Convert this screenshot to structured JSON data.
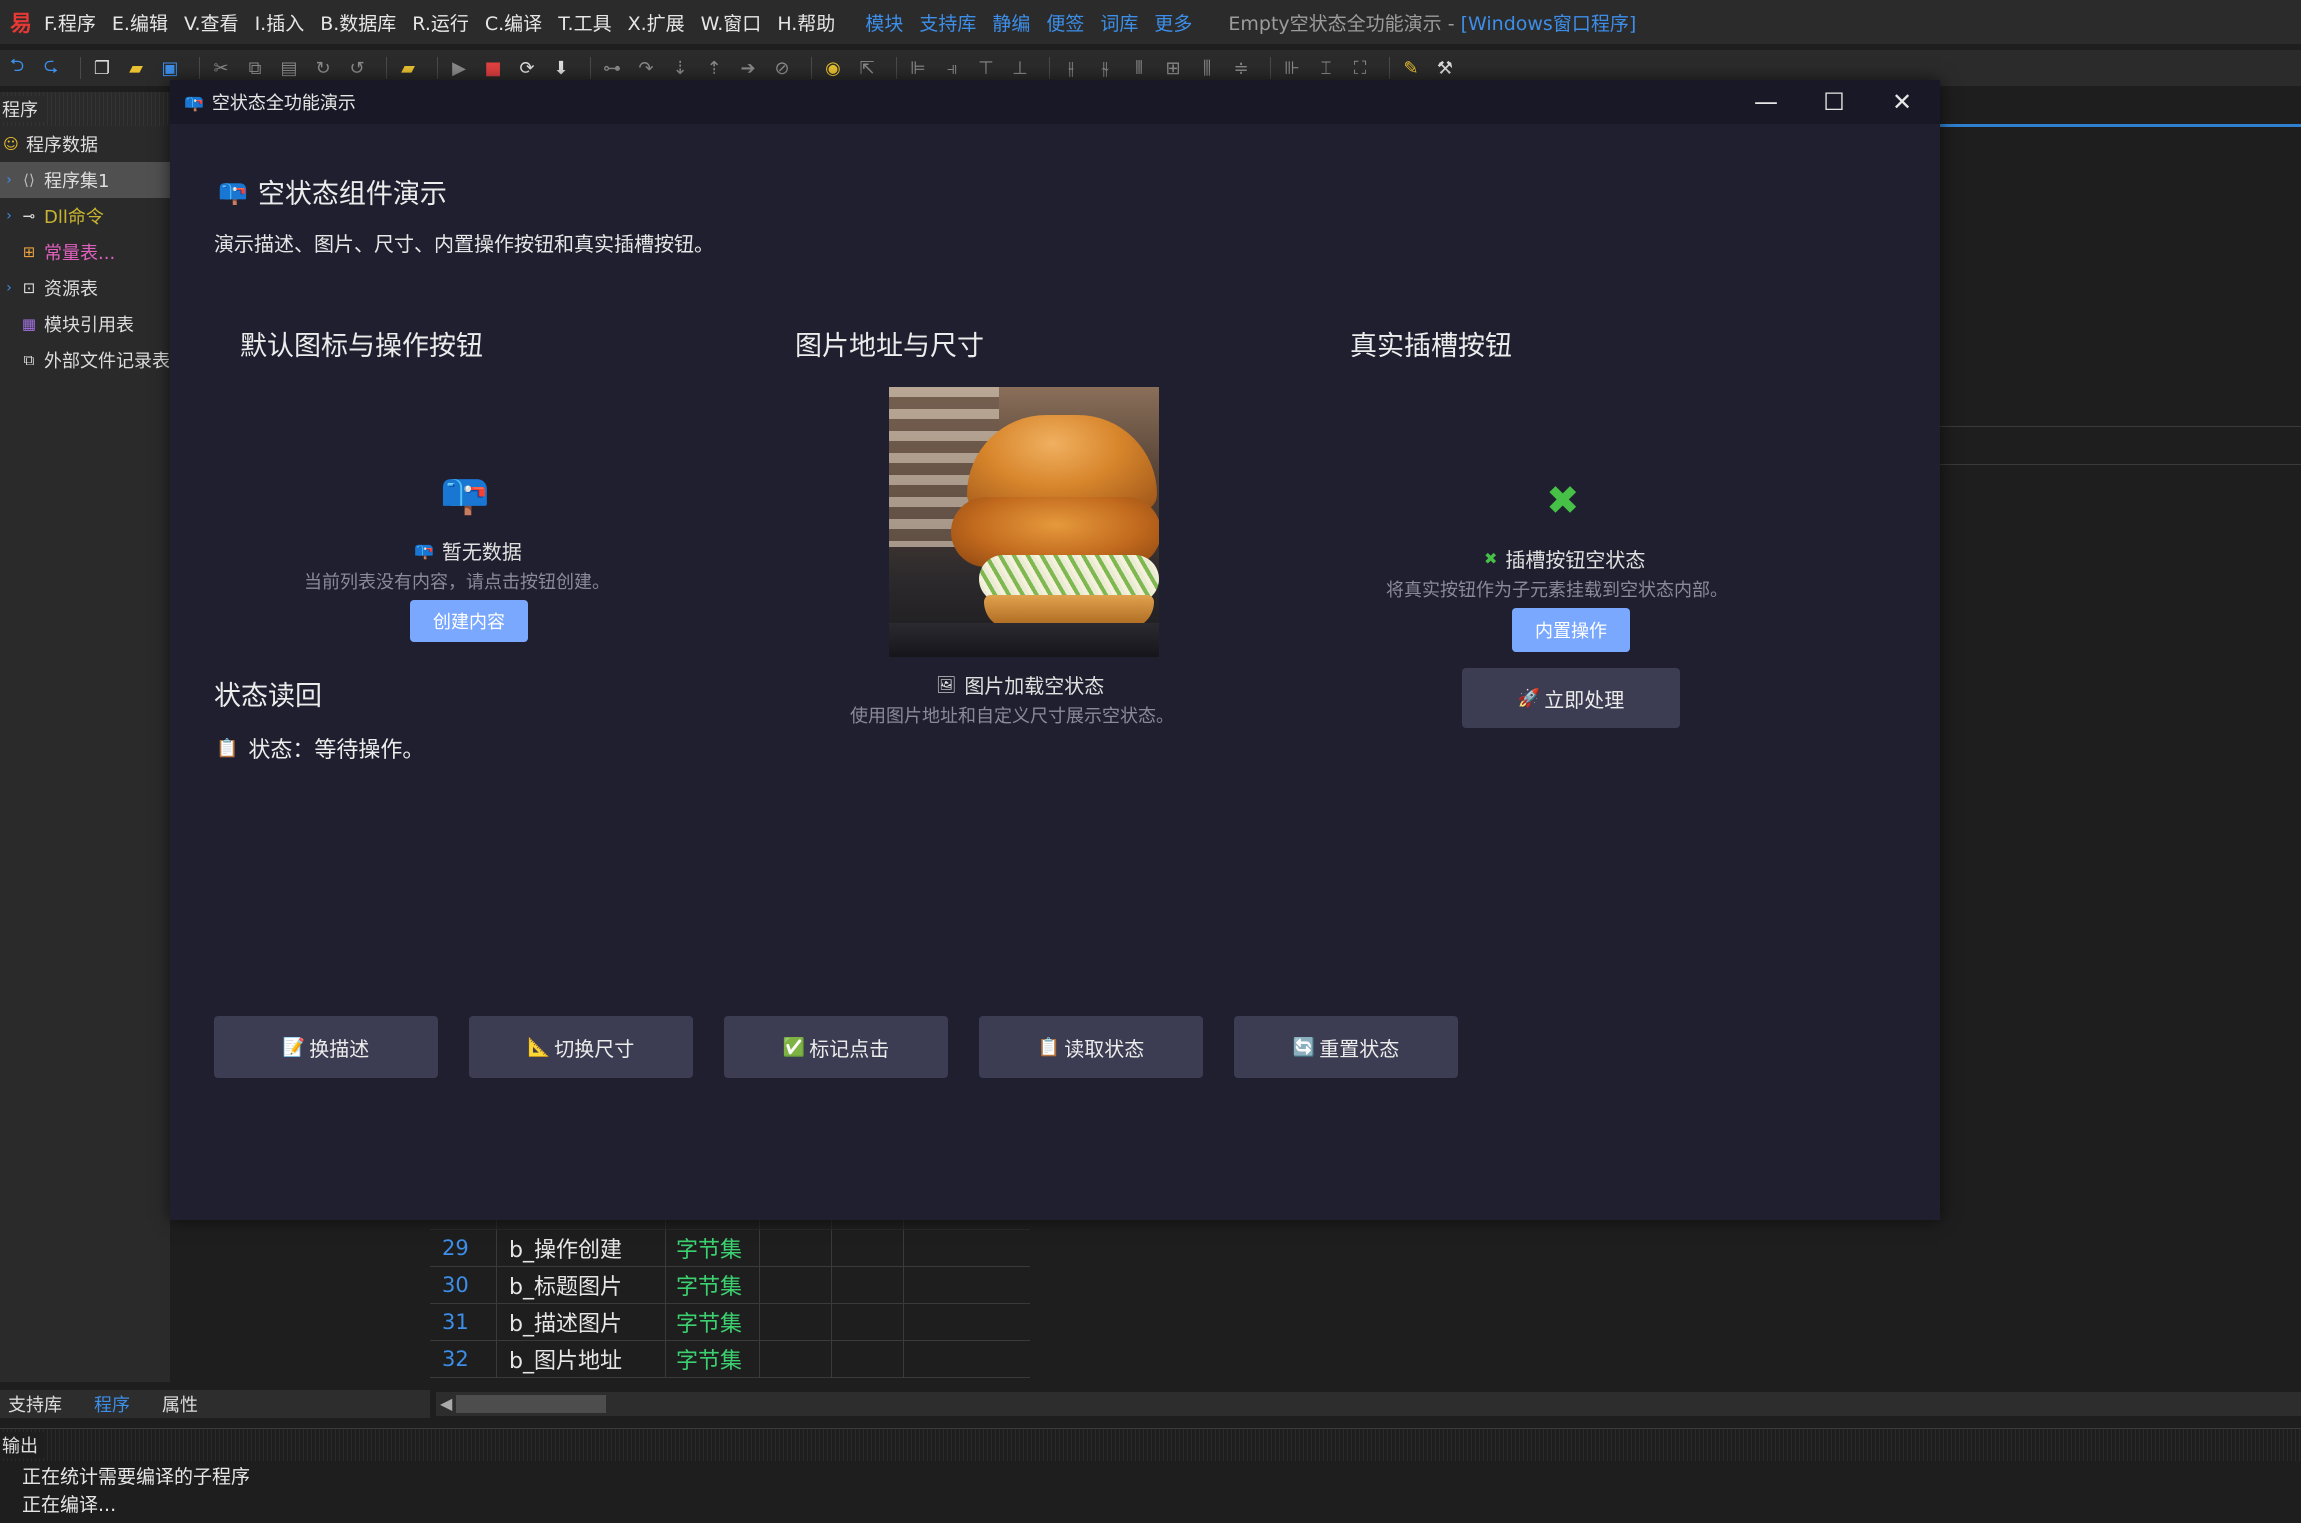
{
  "ide": {
    "logo": "易",
    "menus": [
      "F.程序",
      "E.编辑",
      "V.查看",
      "I.插入",
      "B.数据库",
      "R.运行",
      "C.编译",
      "T.工具",
      "X.扩展",
      "W.窗口",
      "H.帮助"
    ],
    "quick_links": [
      "模块",
      "支持库",
      "静编",
      "便签",
      "词库",
      "更多"
    ],
    "title_prefix": "Empty空状态全功能演示 - ",
    "title_suffix": "[Windows窗口程序]"
  },
  "side_panel": {
    "header": "程序",
    "items": [
      {
        "label": "程序数据",
        "icon": "☺"
      },
      {
        "label": "程序集1",
        "icon": "⟨⟩"
      },
      {
        "label": "Dll命令",
        "icon": "⊸"
      },
      {
        "label": "常量表...",
        "icon": "⊞"
      },
      {
        "label": "资源表",
        "icon": "⊡"
      },
      {
        "label": "模块引用表",
        "icon": "▦"
      },
      {
        "label": "外部文件记录表",
        "icon": "⧉"
      }
    ]
  },
  "editor": {
    "rows": [
      {
        "line": "29",
        "name": "b_操作创建",
        "type": "字节集"
      },
      {
        "line": "30",
        "name": "b_标题图片",
        "type": "字节集"
      },
      {
        "line": "31",
        "name": "b_描述图片",
        "type": "字节集"
      },
      {
        "line": "32",
        "name": "b_图片地址",
        "type": "字节集"
      }
    ]
  },
  "bottom_tabs": [
    "支持库",
    "程序",
    "属性"
  ],
  "output": {
    "header": "输出",
    "lines": [
      "正在统计需要编译的子程序",
      "正在编译..."
    ]
  },
  "dialog": {
    "title": "空状态全功能演示",
    "heading": "空状态组件演示",
    "description": "演示描述、图片、尺寸、内置操作按钮和真实插槽按钮。",
    "col1": {
      "title": "默认图标与操作按钮",
      "empty_title": "暂无数据",
      "empty_desc": "当前列表没有内容，请点击按钮创建。",
      "button": "创建内容"
    },
    "col2": {
      "title": "图片地址与尺寸",
      "empty_title": "图片加载空状态",
      "empty_desc": "使用图片地址和自定义尺寸展示空状态。"
    },
    "col3": {
      "title": "真实插槽按钮",
      "empty_title": "插槽按钮空状态",
      "empty_desc": "将真实按钮作为子元素挂载到空状态内部。",
      "builtin_button": "内置操作",
      "slot_button": "立即处理"
    },
    "status_title": "状态读回",
    "status_text": "状态：等待操作。",
    "actions": [
      "换描述",
      "切换尺寸",
      "标记点击",
      "读取状态",
      "重置状态"
    ]
  },
  "colors": {
    "accent_blue": "#3d8ee8",
    "primary_button": "#7aa8ff",
    "dialog_bg": "#1f1f2f",
    "type_green": "#3cd070"
  }
}
